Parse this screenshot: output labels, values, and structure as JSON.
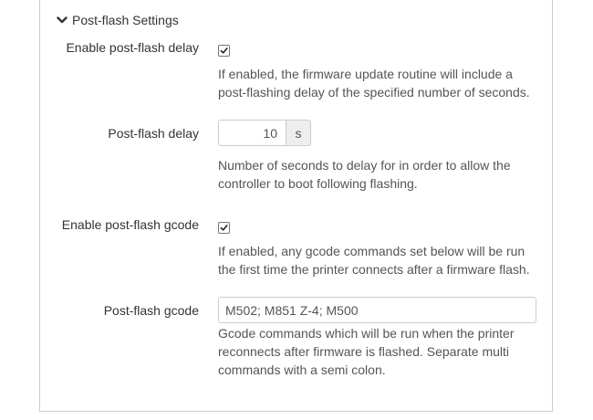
{
  "section": {
    "title": "Post-flash Settings",
    "expanded_icon": "chevron-down-icon"
  },
  "fields": {
    "enable_delay": {
      "label": "Enable post-flash delay",
      "checked": true,
      "help": "If enabled, the firmware update routine will include a post-flashing delay of the specified number of seconds."
    },
    "delay": {
      "label": "Post-flash delay",
      "value": "10",
      "unit": "s",
      "help": "Number of seconds to delay for in order to allow the controller to boot following flashing."
    },
    "enable_gcode": {
      "label": "Enable post-flash gcode",
      "checked": true,
      "help": "If enabled, any gcode commands set below will be run the first time the printer connects after a firmware flash."
    },
    "gcode": {
      "label": "Post-flash gcode",
      "value": "M502; M851 Z-4; M500",
      "help": "Gcode commands which will be run when the printer reconnects after firmware is flashed. Separate multi commands with a semi colon."
    }
  }
}
